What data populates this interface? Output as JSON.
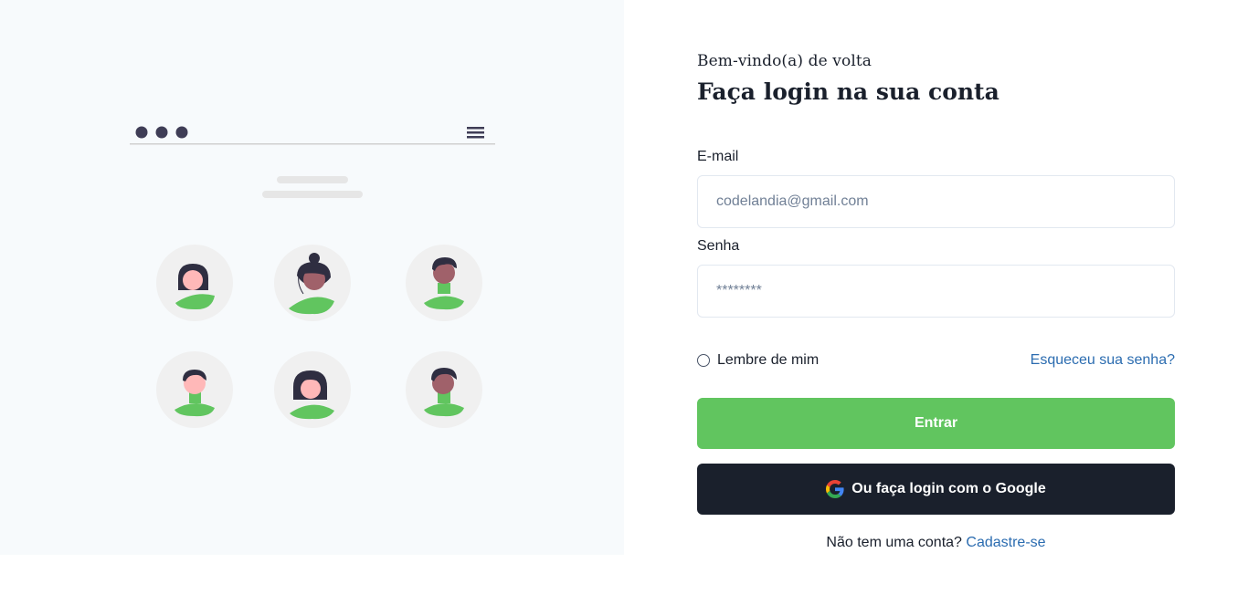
{
  "welcome": "Bem-vindo(a) de volta",
  "title": "Faça login na sua conta",
  "email": {
    "label": "E-mail",
    "placeholder": "codelandia@gmail.com",
    "value": ""
  },
  "password": {
    "label": "Senha",
    "placeholder": "********",
    "value": ""
  },
  "remember_label": "Lembre de mim",
  "forgot_link": "Esqueceu sua senha?",
  "login_button": "Entrar",
  "google_button": "Ou faça login com o Google",
  "signup": {
    "prompt": "Não tem uma conta?",
    "link": "Cadastre-se"
  },
  "colors": {
    "accent_green": "#61c55f",
    "dark_button": "#1a202c",
    "link_blue": "#2b6cb0",
    "panel_bg": "#f7fafc"
  },
  "illustration": {
    "icons": [
      "dots-icon",
      "hamburger-menu-icon"
    ],
    "avatars": 6
  }
}
